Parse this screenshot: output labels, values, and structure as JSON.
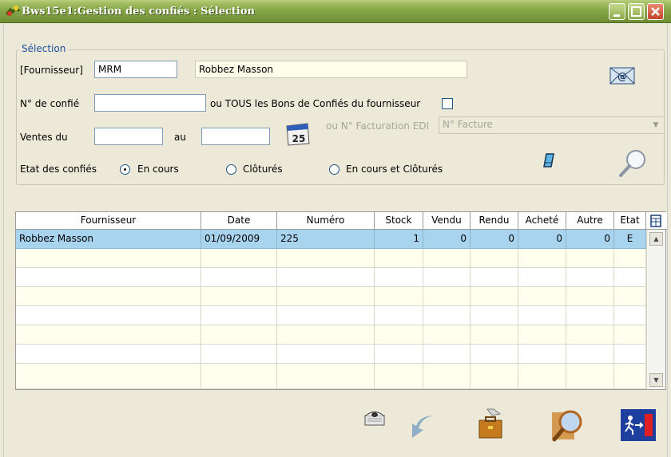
{
  "window": {
    "title": "Bws15e1:Gestion des confiés : Sélection",
    "minimize": "_",
    "maximize": "□",
    "close": "X"
  },
  "selection": {
    "legend": "Sélection",
    "fournisseur_label": "[Fournisseur]",
    "fournisseur_code": "MRM",
    "fournisseur_name": "Robbez Masson",
    "confie_label": "N° de confié",
    "confie_value": "",
    "tous_label": "ou TOUS les Bons de Confiés du fournisseur",
    "ventes_label": "Ventes du",
    "ventes_from": "",
    "au_label": "au",
    "ventes_to": "",
    "calendar_day": "25",
    "edi_label": "ou N° Facturation EDI",
    "edi_value": "N° Facture",
    "etat_label": "Etat des confiés",
    "radio_en_cours": "En cours",
    "radio_clotures": "Clôturés",
    "radio_both": "En cours et Clôturés",
    "email_glyph": "@"
  },
  "grid": {
    "columns": [
      "Fournisseur",
      "Date",
      "Numéro",
      "Stock",
      "Vendu",
      "Rendu",
      "Acheté",
      "Autre",
      "Etat"
    ],
    "rows": [
      [
        "Robbez Masson",
        "01/09/2009",
        "225",
        "1",
        "0",
        "0",
        "0",
        "0",
        "E"
      ]
    ]
  },
  "colors": {
    "title_green": "#86a648",
    "selected_row": "#a8d4ef",
    "row_tint": "#fffff0",
    "exit_red": "#e02020",
    "exit_blue": "#1e3f9e"
  }
}
